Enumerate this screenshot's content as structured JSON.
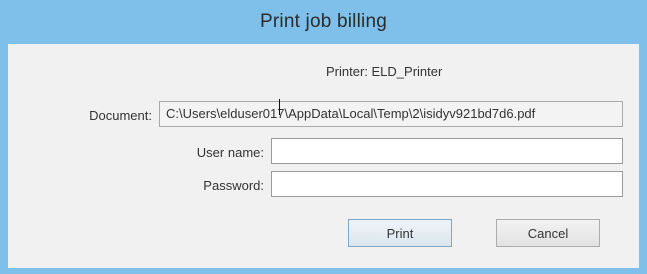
{
  "window": {
    "title": "Print job billing"
  },
  "printer": {
    "label": "Printer: ELD_Printer"
  },
  "document": {
    "label": "Document:",
    "value": "C:\\Users\\elduser017\\AppData\\Local\\Temp\\2\\isidyv921bd7d6.pdf"
  },
  "username": {
    "label": "User name:",
    "value": ""
  },
  "password": {
    "label": "Password:",
    "value": ""
  },
  "buttons": {
    "print": "Print",
    "cancel": "Cancel"
  },
  "colors": {
    "frame": "#7fc0ea",
    "client": "#f1f1f1"
  }
}
